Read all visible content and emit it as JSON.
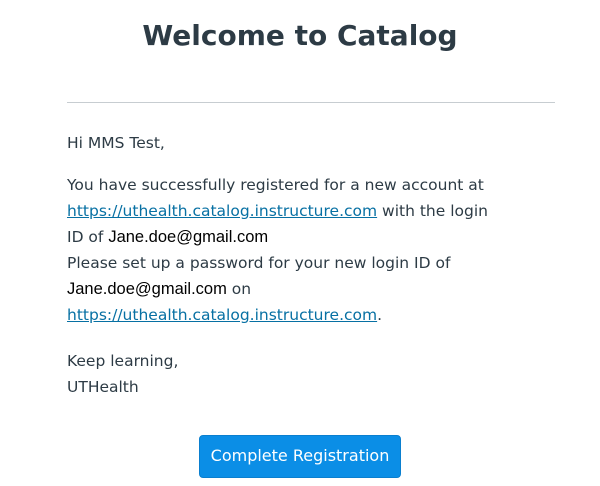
{
  "email": {
    "title": "Welcome to Catalog",
    "greeting": "Hi MMS Test,",
    "paragraph1": {
      "line1": "You have successfully registered for a new account at",
      "link": "https://uthealth.catalog.instructure.com",
      "after_link": " with the login",
      "id_prefix": "ID of ",
      "login_id": "Jane.doe@gmail.com"
    },
    "paragraph2": {
      "line1": "Please set up a password for your new login ID of",
      "login_id": "Jane.doe@gmail.com",
      "on": " on",
      "link": "https://uthealth.catalog.instructure.com",
      "period": "."
    },
    "signoff": {
      "line1": "Keep learning,",
      "line2": "UTHealth"
    },
    "button_label": "Complete Registration"
  },
  "colors": {
    "link": "#0770a3",
    "button": "#0b8ee6",
    "text": "#2d3b45",
    "divider": "#c7cdd1"
  }
}
